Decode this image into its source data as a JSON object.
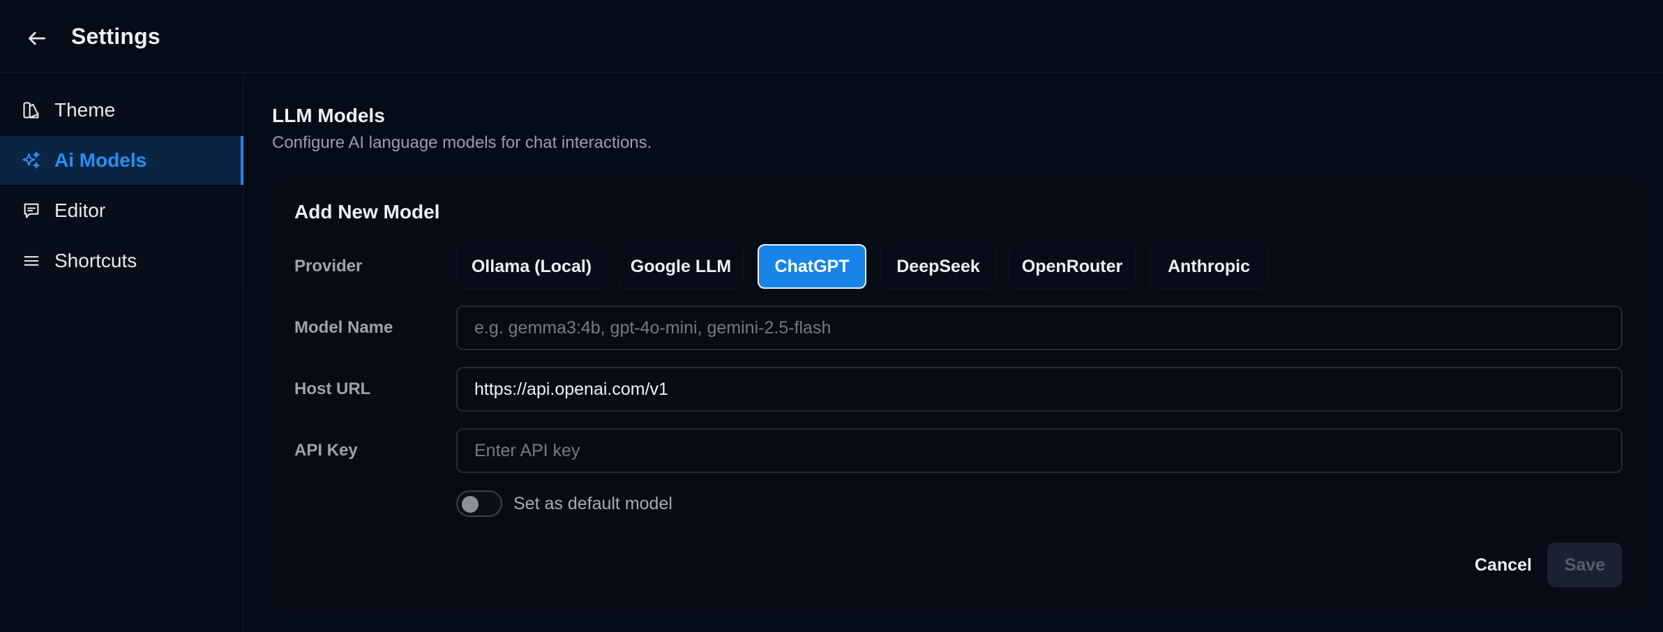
{
  "header": {
    "title": "Settings",
    "back_icon": "arrow-left-icon"
  },
  "sidebar": {
    "items": [
      {
        "label": "Theme",
        "icon": "palette-icon",
        "active": false
      },
      {
        "label": "Ai Models",
        "icon": "sparkles-icon",
        "active": true
      },
      {
        "label": "Editor",
        "icon": "message-square-icon",
        "active": false
      },
      {
        "label": "Shortcuts",
        "icon": "menu-lines-icon",
        "active": false
      }
    ]
  },
  "main": {
    "title": "LLM Models",
    "subtitle": "Configure AI language models for chat interactions.",
    "form": {
      "title": "Add New Model",
      "provider_label": "Provider",
      "providers": [
        "Ollama (Local)",
        "Google LLM",
        "ChatGPT",
        "DeepSeek",
        "OpenRouter",
        "Anthropic"
      ],
      "selected_provider": "ChatGPT",
      "model_name_label": "Model Name",
      "model_name_placeholder": "e.g. gemma3:4b, gpt-4o-mini, gemini-2.5-flash",
      "model_name_value": "",
      "host_url_label": "Host URL",
      "host_url_value": "https://api.openai.com/v1",
      "api_key_label": "API Key",
      "api_key_placeholder": "Enter API key",
      "api_key_value": "",
      "default_toggle_label": "Set as default model",
      "default_toggle_on": false,
      "cancel_label": "Cancel",
      "save_label": "Save"
    }
  },
  "colors": {
    "background": "#050b17",
    "accent": "#1784e8",
    "active_nav_bg": "#0a2443",
    "active_nav_text": "#2b8ff0"
  }
}
